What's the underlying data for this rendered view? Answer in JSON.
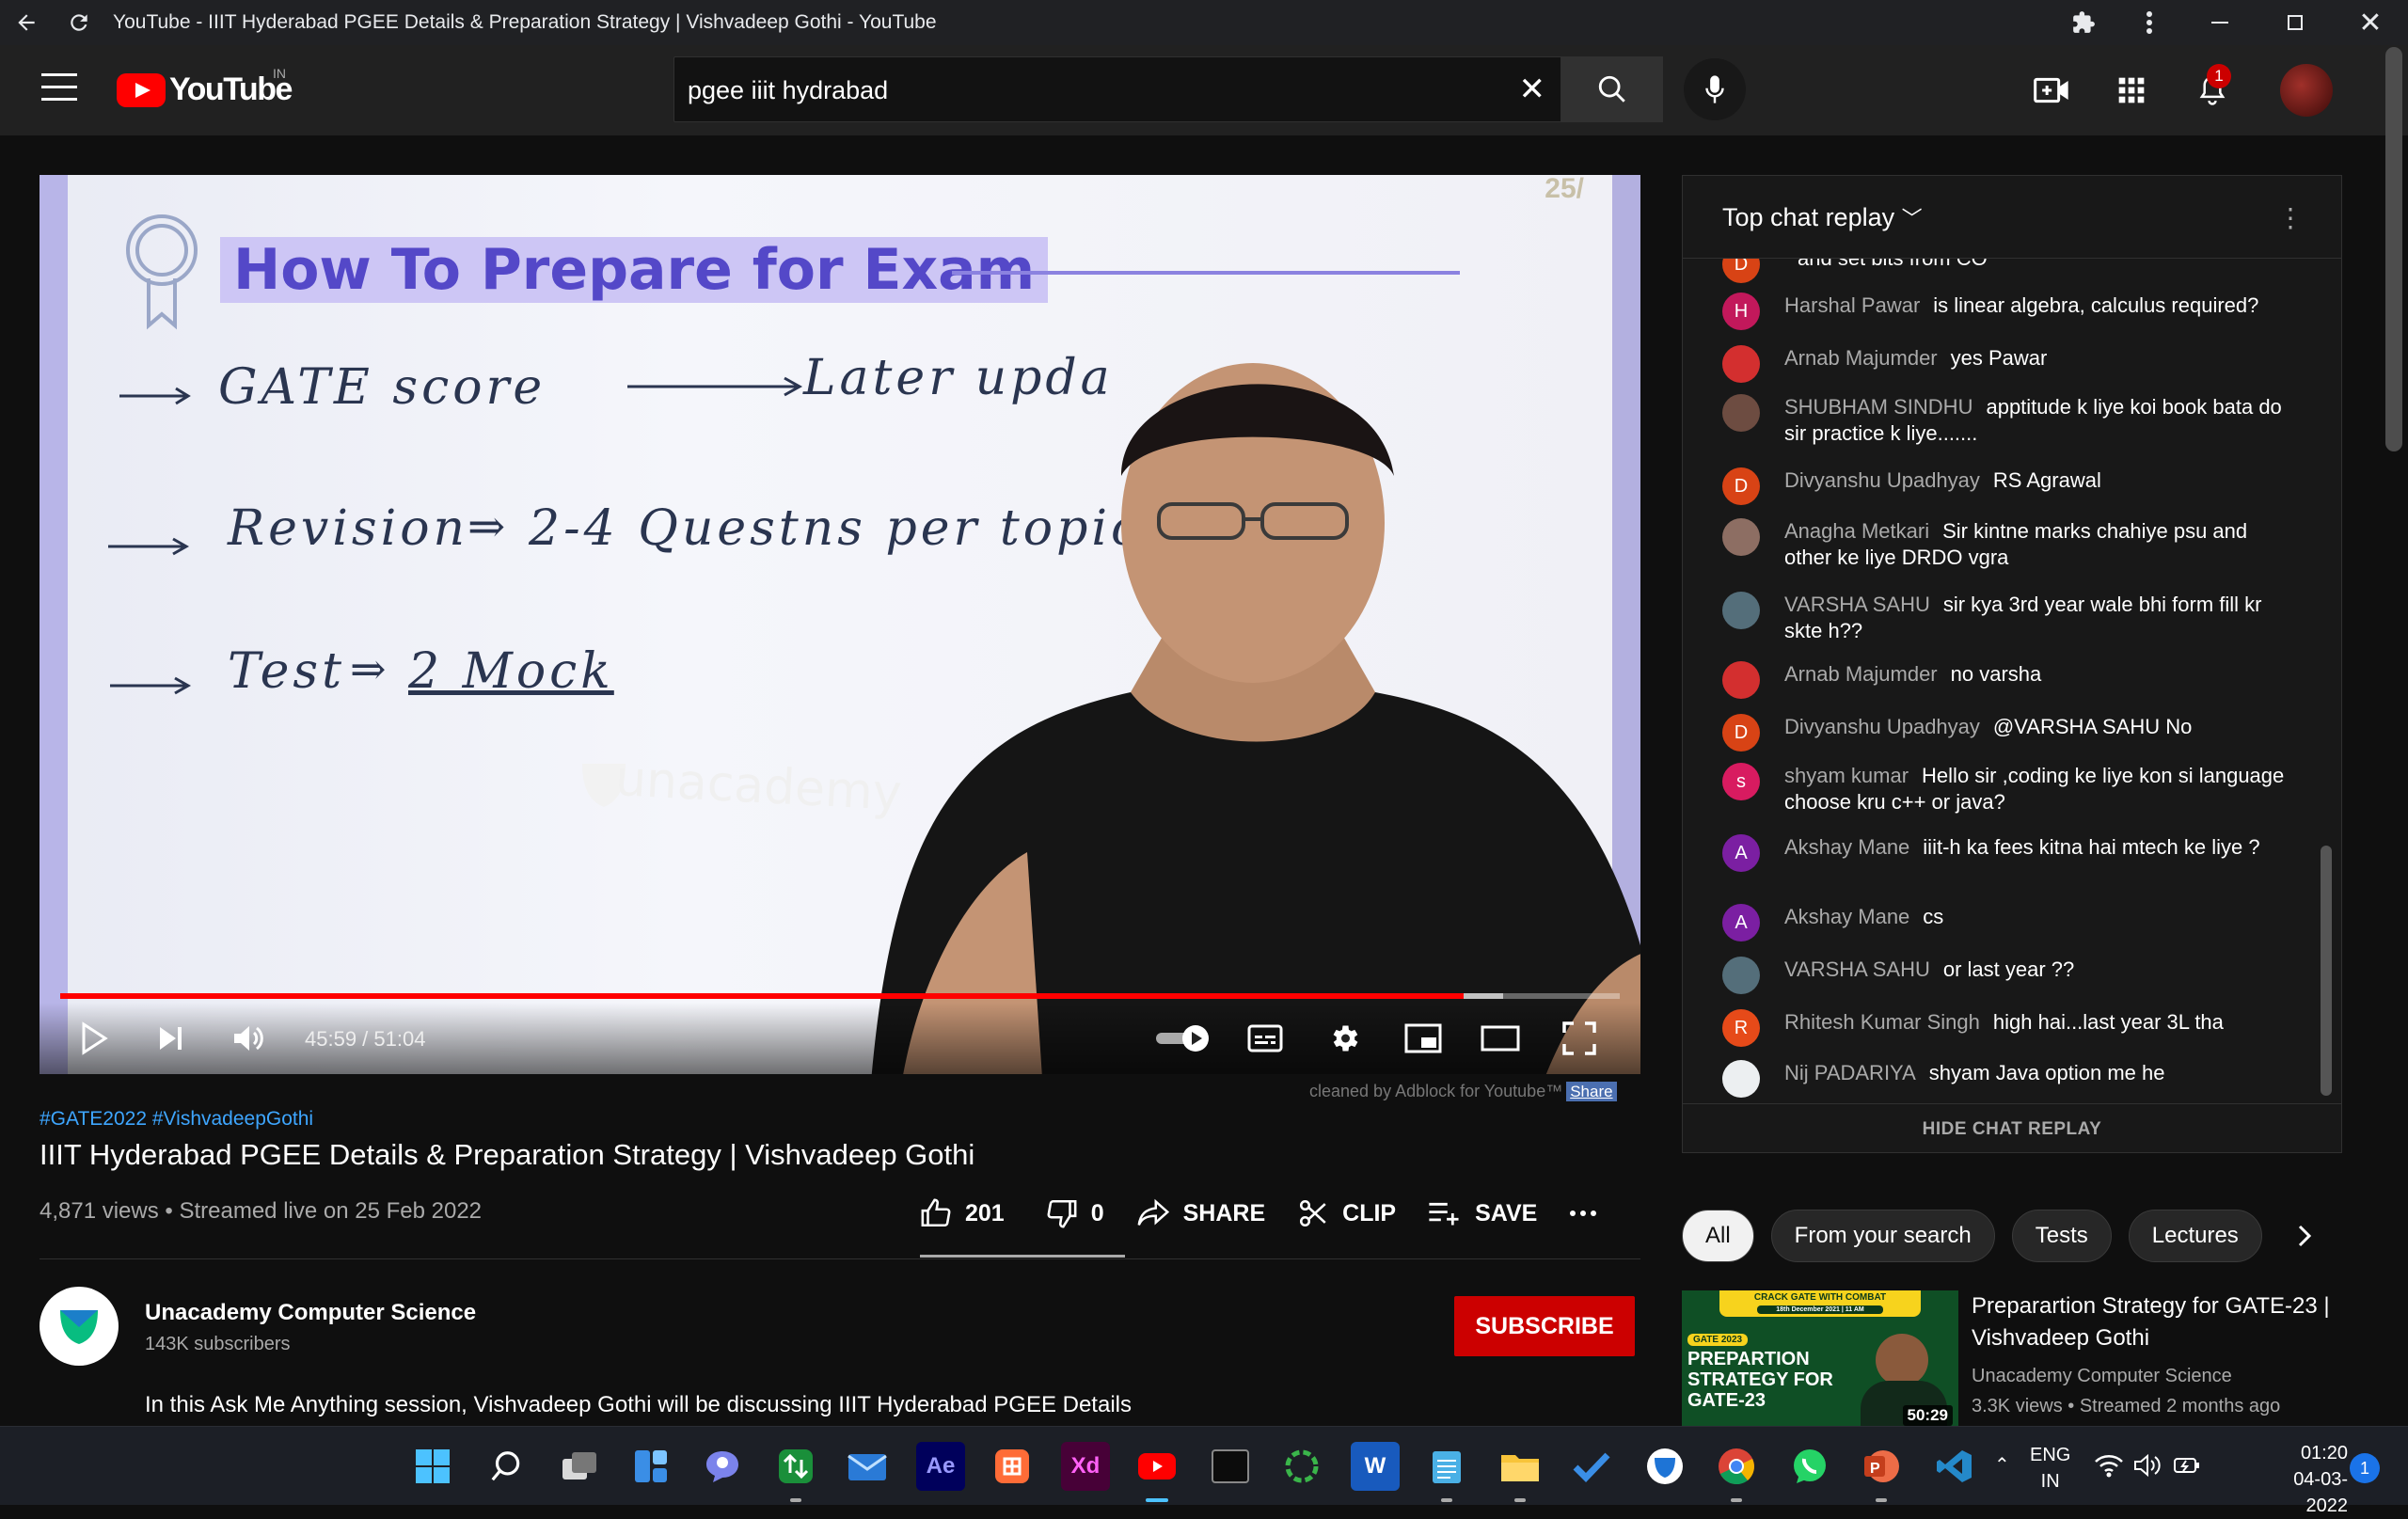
{
  "window": {
    "title": "YouTube - IIIT Hyderabad PGEE Details & Preparation Strategy | Vishvadeep Gothi - YouTube"
  },
  "header": {
    "logo_text": "YouTube",
    "country_code": "IN",
    "search_value": "pgee iiit hydrabad",
    "notification_count": "1"
  },
  "video": {
    "board_heading": "How To Prepare for Exam",
    "board_lines": [
      "GATE score",
      "Later upda",
      "Revision",
      "2-4 Questns per topic",
      "Test",
      "2 Mock"
    ],
    "slide_number": "25/",
    "shirt_brand": "unacademy",
    "time_display": "45:59 / 51:04",
    "progress": 0.9,
    "buffered": 0.925,
    "adblock_text": "cleaned by Adblock for Youtube™",
    "adblock_share": "Share"
  },
  "info": {
    "hashtags": "#GATE2022 #VishvadeepGothi",
    "title": "IIIT Hyderabad PGEE Details & Preparation Strategy | Vishvadeep Gothi",
    "meta": "4,871 views • Streamed live on 25 Feb 2022",
    "likes": "201",
    "dislikes": "0",
    "share_label": "SHARE",
    "clip_label": "CLIP",
    "save_label": "SAVE"
  },
  "channel": {
    "name": "Unacademy Computer Science",
    "subscribers": "143K subscribers",
    "subscribe_label": "SUBSCRIBE",
    "description": "In this Ask Me Anything session, Vishvadeep Gothi will be discussing IIIT Hyderabad PGEE Details"
  },
  "chat": {
    "title": "Top chat replay",
    "hide_label": "HIDE CHAT REPLAY",
    "messages": [
      {
        "author": "",
        "text": "and set bits from CO",
        "initial": "D",
        "color": "#d84315"
      },
      {
        "author": "Harshal Pawar",
        "text": "is linear algebra, calculus required?",
        "initial": "H",
        "color": "#c2185b"
      },
      {
        "author": "Arnab Majumder",
        "text": "yes Pawar",
        "initial": "",
        "color": "#d32f2f"
      },
      {
        "author": "SHUBHAM SINDHU",
        "text": "apptitude k liye koi book bata do sir practice k liye.......",
        "initial": "",
        "color": "#6d4c41"
      },
      {
        "author": "Divyanshu Upadhyay",
        "text": "RS Agrawal",
        "initial": "D",
        "color": "#d84315"
      },
      {
        "author": "Anagha Metkari",
        "text": "Sir kintne marks chahiye psu and other ke liye DRDO vgra",
        "initial": "",
        "color": "#8d6e63"
      },
      {
        "author": "VARSHA SAHU",
        "text": "sir kya 3rd year wale bhi form fill kr skte h??",
        "initial": "",
        "color": "#546e7a"
      },
      {
        "author": "Arnab Majumder",
        "text": "no varsha",
        "initial": "",
        "color": "#d32f2f"
      },
      {
        "author": "Divyanshu Upadhyay",
        "text": "@VARSHA SAHU No",
        "initial": "D",
        "color": "#d84315"
      },
      {
        "author": "shyam kumar",
        "text": "Hello sir ,coding ke liye kon si language choose kru c++ or java?",
        "initial": "s",
        "color": "#d81b60"
      },
      {
        "author": "Akshay Mane",
        "text": "iiit-h ka fees kitna hai mtech ke liye ?",
        "initial": "A",
        "color": "#7b1fa2"
      },
      {
        "author": "Akshay Mane",
        "text": "cs",
        "initial": "A",
        "color": "#7b1fa2"
      },
      {
        "author": "VARSHA SAHU",
        "text": "or last year ??",
        "initial": "",
        "color": "#546e7a"
      },
      {
        "author": "Rhitesh Kumar Singh",
        "text": "high hai...last year 3L tha",
        "initial": "R",
        "color": "#e64a19"
      },
      {
        "author": "Nij PADARIYA",
        "text": "shyam Java option me he",
        "initial": "",
        "color": "#eceff1"
      }
    ]
  },
  "chips": [
    "All",
    "From your search",
    "Tests",
    "Lectures"
  ],
  "recommendation": {
    "title": "Preparartion Strategy for GATE-23 | Vishvadeep Gothi",
    "channel": "Unacademy Computer Science",
    "meta": "3.3K views • Streamed 2 months ago",
    "thumb_banner": "CRACK GATE WITH COMBAT",
    "thumb_date": "18th December 2021 | 11 AM",
    "thumb_tag": "GATE 2023",
    "thumb_text": "PREPARTION STRATEGY FOR GATE-23",
    "duration": "50:29"
  },
  "taskbar": {
    "lang_top": "ENG",
    "lang_bottom": "IN",
    "time": "01:20",
    "date": "04-03-2022",
    "notif_count": "1"
  },
  "colors": {
    "yt_red": "#ff0000",
    "link_blue": "#3ea6ff",
    "subscribe_red": "#cc0000"
  }
}
